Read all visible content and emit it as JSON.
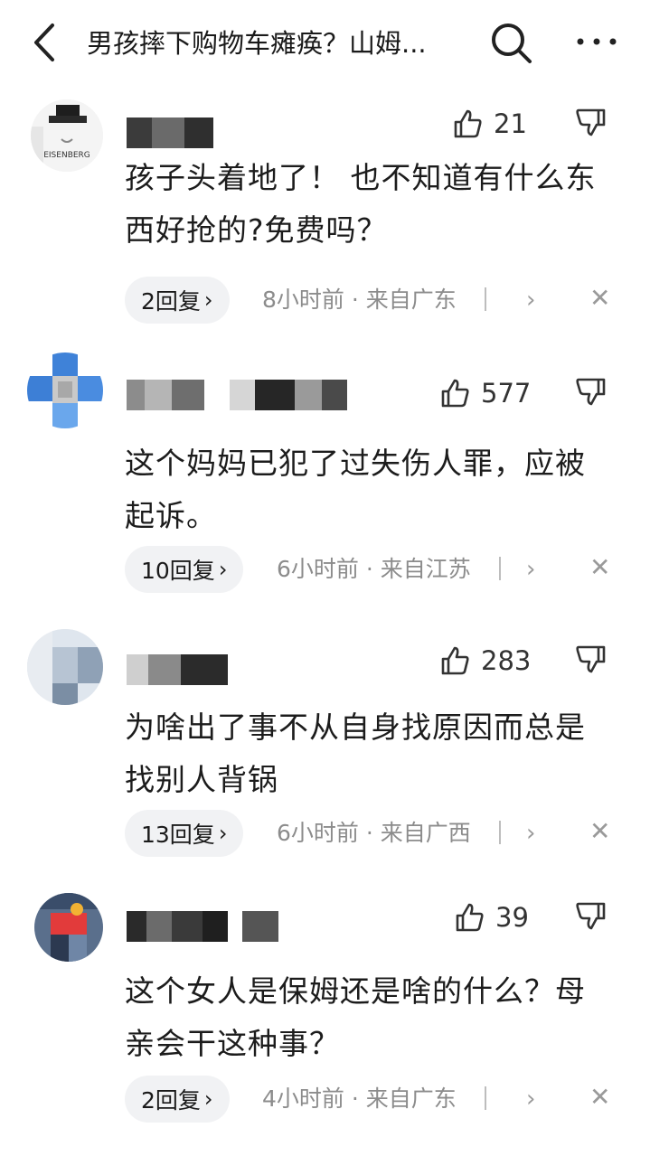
{
  "header": {
    "title": "男孩摔下购物车瘫痪？山姆...",
    "back_icon": "chevron-left-icon",
    "search_icon": "search-icon",
    "more_icon": "more-horizontal-icon"
  },
  "avatar_logo_text": "EISENBERG",
  "comments": [
    {
      "likes": "21",
      "text_line1": "孩子头着地了！ 也不知道有什么东",
      "text_line2": "西好抢的?免费吗？",
      "replies": "2回复",
      "reply_chevron": "›",
      "meta": "8小时前 · 来自广东",
      "expand": "›",
      "close": "✕"
    },
    {
      "likes": "577",
      "text_line1": "这个妈妈已犯了过失伤人罪，应被",
      "text_line2": "起诉。",
      "replies": "10回复",
      "reply_chevron": "›",
      "meta": "6小时前 · 来自江苏",
      "expand": "›",
      "close": "✕"
    },
    {
      "likes": "283",
      "text_line1": "为啥出了事不从自身找原因而总是",
      "text_line2": "找别人背锅",
      "replies": "13回复",
      "reply_chevron": "›",
      "meta": "6小时前 · 来自广西",
      "expand": "›",
      "close": "✕"
    },
    {
      "likes": "39",
      "text_line1": "这个女人是保姆还是啥的什么？母",
      "text_line2": "亲会干这种事？",
      "replies": "2回复",
      "reply_chevron": "›",
      "meta": "4小时前 · 来自广东",
      "expand": "›",
      "close": "✕"
    }
  ]
}
